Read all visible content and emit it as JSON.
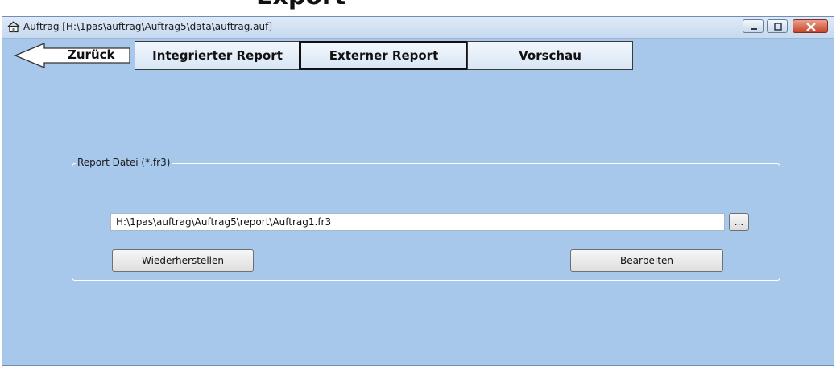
{
  "top_heading": "Export",
  "window": {
    "title": "Auftrag [H:\\1pas\\auftrag\\Auftrag5\\data\\auftrag.auf]",
    "app_icon": "house-icon",
    "controls": [
      "minimize-icon",
      "maximize-icon",
      "close-icon"
    ]
  },
  "nav": {
    "back_label": "Zurück",
    "back_icon": "arrow-left-icon",
    "tabs": [
      {
        "label": "Integrierter Report",
        "active": false
      },
      {
        "label": "Externer Report",
        "active": true
      },
      {
        "label": "Vorschau",
        "active": false
      }
    ]
  },
  "report": {
    "group_label": "Report Datei (*.fr3)",
    "file_path": "H:\\1pas\\auftrag\\Auftrag5\\report\\Auftrag1.fr3",
    "browse_label": "...",
    "restore_label": "Wiederherstellen",
    "edit_label": "Bearbeiten"
  },
  "colors": {
    "background": "#a7c8eb",
    "close_button": "#c8452b"
  }
}
